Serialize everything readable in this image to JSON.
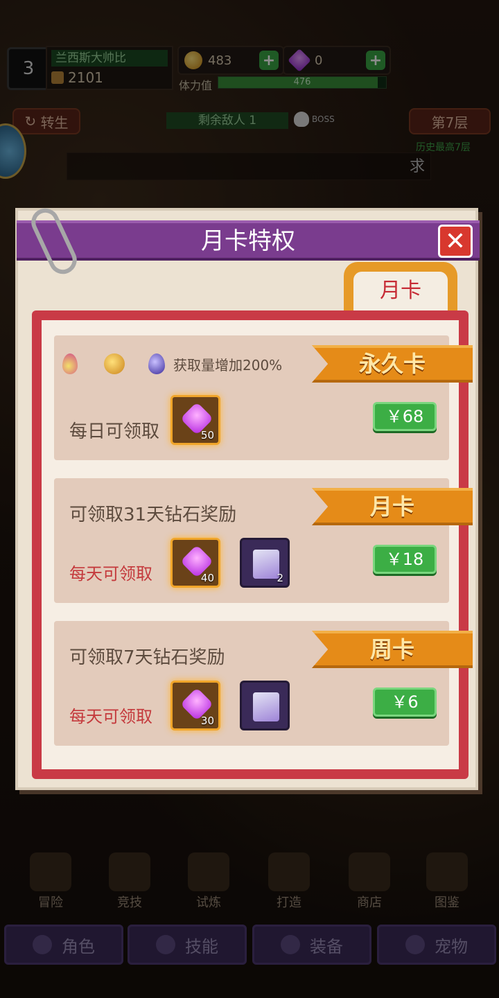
{
  "hud": {
    "level": "3",
    "player_name": "兰西斯大帅比",
    "power": "2101",
    "gold": "483",
    "gems": "0",
    "stamina_label": "体力值",
    "stamina_value": "476",
    "stamina_fraction": 0.95,
    "rebirth_label": "转生",
    "enemies_label": "剩余敌人 1",
    "boss_label": "BOSS",
    "floor_label": "第7层",
    "record_label": "历史最高7层",
    "strip_text": "求"
  },
  "modal": {
    "title": "月卡特权",
    "tab_label": "月卡",
    "cards": [
      {
        "banner": "永久卡",
        "bonus_text": "获取量增加200%",
        "daily_label": "每日可领取",
        "gem_count": "50",
        "price": "￥68"
      },
      {
        "banner": "月卡",
        "title": "可领取31天钻石奖励",
        "daily_label": "每天可领取",
        "gem_count": "40",
        "item_count": "2",
        "price": "￥18"
      },
      {
        "banner": "周卡",
        "title": "可领取7天钻石奖励",
        "daily_label": "每天可领取",
        "gem_count": "30",
        "price": "￥6"
      }
    ]
  },
  "nav": {
    "items": [
      "冒险",
      "竞技",
      "试炼",
      "打造",
      "商店",
      "图鉴"
    ],
    "tabs": [
      "角色",
      "技能",
      "装备",
      "宠物"
    ]
  },
  "colors": {
    "header_purple": "#7a3c8e",
    "banner_orange": "#e58b18",
    "price_green": "#3cae45",
    "frame_red": "#c93a46"
  }
}
